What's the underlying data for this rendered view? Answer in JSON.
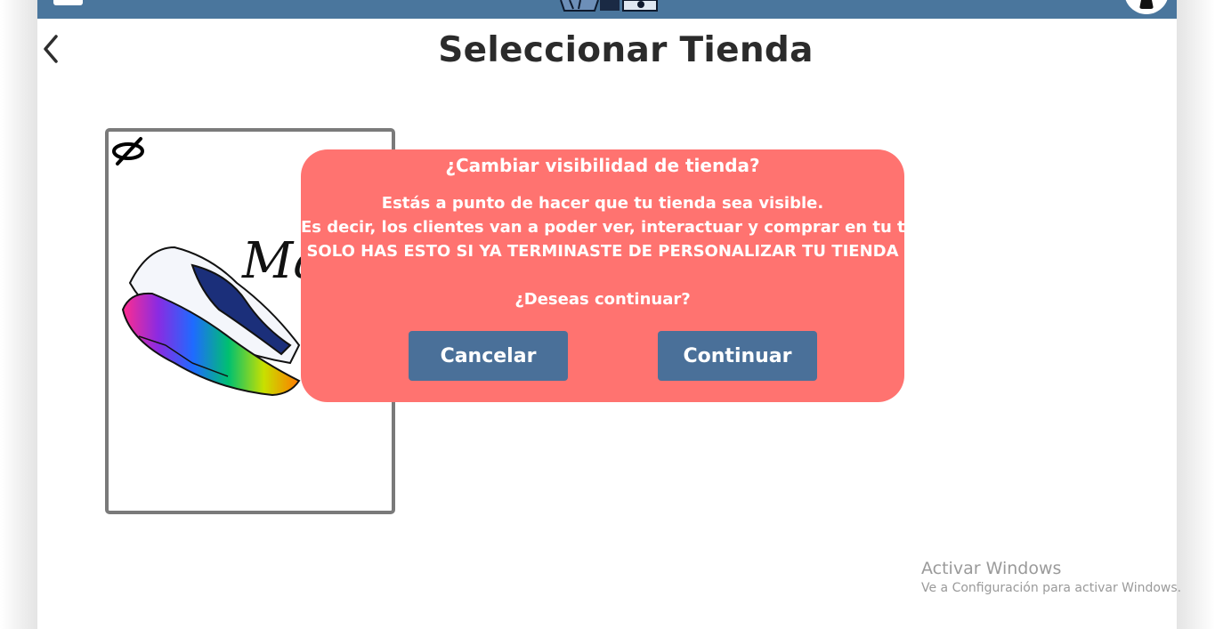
{
  "page": {
    "title": "Seleccionar Tienda"
  },
  "store_card": {
    "brand_text": "Ma S",
    "visibility": "hidden"
  },
  "modal": {
    "title": "¿Cambiar visibilidad de tienda?",
    "line1": "Estás a punto de hacer que tu tienda sea visible.",
    "line2": "Es decir, los clientes van a poder ver, interactuar y comprar en tu tienda.",
    "line3": "SOLO HAS ESTO SI YA TERMINASTE DE PERSONALIZAR TU TIENDA",
    "question": "¿Deseas continuar?",
    "cancel_label": "Cancelar",
    "continue_label": "Continuar"
  },
  "watermark": {
    "title": "Activar Windows",
    "subtitle": "Ve a Configuración para activar Windows."
  },
  "colors": {
    "topbar": "#4a769d",
    "modal_bg": "#ff7370",
    "button_bg": "#4a7099",
    "card_border": "#7a7a7a"
  },
  "icons": [
    "menu-icon",
    "logo-icon",
    "user-icon",
    "back-chevron-icon",
    "eye-off-icon"
  ]
}
